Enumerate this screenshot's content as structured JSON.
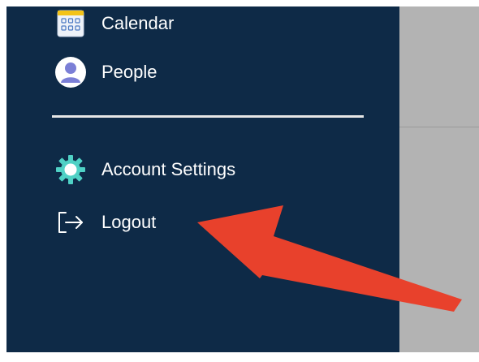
{
  "sidebar": {
    "items": [
      {
        "label": "Calendar",
        "icon": "calendar-icon"
      },
      {
        "label": "People",
        "icon": "person-icon"
      },
      {
        "label": "Account Settings",
        "icon": "gear-icon"
      },
      {
        "label": "Logout",
        "icon": "logout-icon"
      }
    ]
  },
  "annotation": {
    "arrow_color": "#e8412c",
    "points_to": "Logout"
  },
  "colors": {
    "sidebar_bg": "#0e2a47",
    "content_bg": "#b3b3b3",
    "gear_accent": "#4fd1c5",
    "avatar_accent": "#7b7fd6"
  }
}
